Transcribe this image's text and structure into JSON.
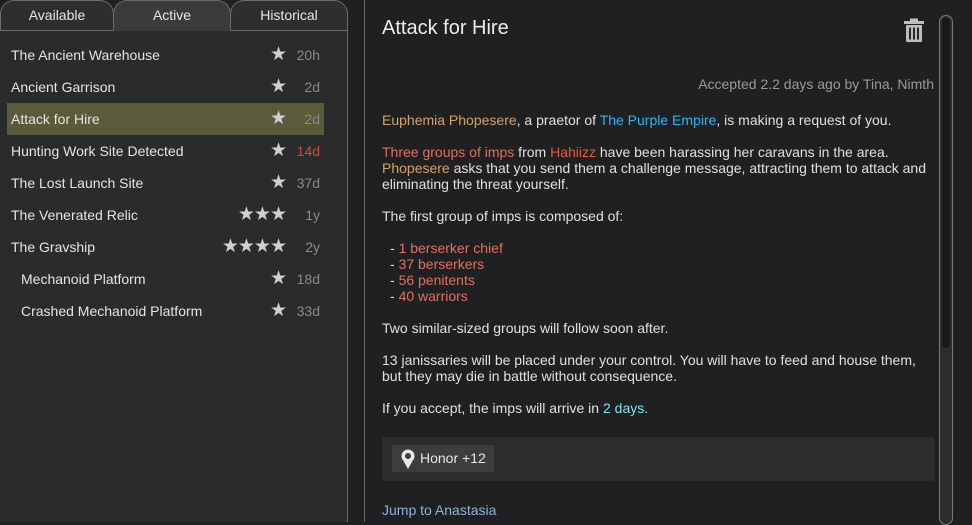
{
  "tabs": [
    {
      "label": "Available"
    },
    {
      "label": "Active"
    },
    {
      "label": "Historical"
    }
  ],
  "quests": [
    {
      "name": "The Ancient Warehouse",
      "stars": "★",
      "age": "20h"
    },
    {
      "name": "Ancient Garrison",
      "stars": "★",
      "age": "2d"
    },
    {
      "name": "Attack for Hire",
      "stars": "★",
      "age": "2d"
    },
    {
      "name": "Hunting Work Site Detected",
      "stars": "★",
      "age": "14d"
    },
    {
      "name": "The Lost Launch Site",
      "stars": "★",
      "age": "37d"
    },
    {
      "name": "The Venerated Relic",
      "stars": "★★★",
      "age": "1y"
    },
    {
      "name": "The Gravship",
      "stars": "★★★★",
      "age": "2y"
    },
    {
      "name": "Mechanoid Platform",
      "stars": "★",
      "age": "18d"
    },
    {
      "name": "Crashed Mechanoid Platform",
      "stars": "★",
      "age": "33d"
    }
  ],
  "detail": {
    "title": "Attack for Hire",
    "accepted": "Accepted 2.2 days ago by Tina, Nimth",
    "p1": {
      "person": "Euphemia Phopesere",
      "t1": ", a praetor of ",
      "faction": "The Purple Empire",
      "t2": ", is making a request of you."
    },
    "p2": {
      "groups": "Three groups of imps",
      "t1": " from ",
      "place": "Hahiizz",
      "t2": " have been harassing her caravans in the area.",
      "name": "Phopesere",
      "t3": " asks that you send them a challenge message, attracting them to attack and eliminating the threat yourself."
    },
    "p3": "The first group of imps is composed of:",
    "composition": [
      "1 berserker chief",
      "37 berserkers",
      "56 penitents",
      "40 warriors"
    ],
    "p4": "Two similar-sized groups will follow soon after.",
    "p5": "13 janissaries will be placed under your control. You will have to feed and house them, but they may die in battle without consequence.",
    "p6": {
      "t1": "If you accept, the imps will arrive in ",
      "time": "2 days",
      "t2": "."
    },
    "reward": "Honor +12",
    "jump": "Jump to Anastasia"
  },
  "icons": {
    "star": "star-icon",
    "trash": "trash-icon",
    "honor": "honor-icon"
  },
  "colors": {
    "selected_row": "#5b5a3a",
    "overdue": "#d54a3c",
    "person": "#d7a06a",
    "faction": "#2fb6f0",
    "enemy": "#e25a3e",
    "time": "#7fe0f0"
  }
}
